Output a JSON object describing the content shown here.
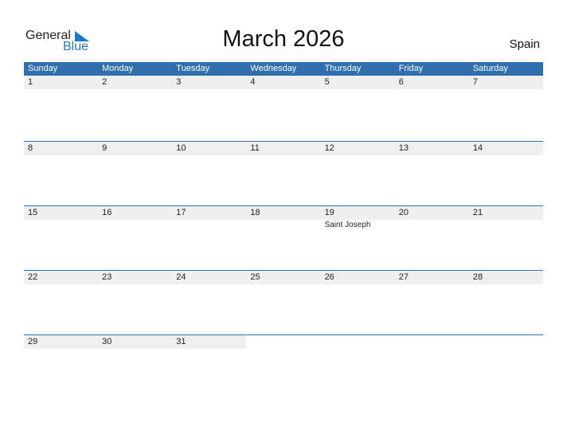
{
  "logo": {
    "general": "General",
    "blue": "Blue"
  },
  "header": {
    "title": "March 2026",
    "country": "Spain"
  },
  "weekdays": [
    "Sunday",
    "Monday",
    "Tuesday",
    "Wednesday",
    "Thursday",
    "Friday",
    "Saturday"
  ],
  "weeks": [
    [
      {
        "d": "1"
      },
      {
        "d": "2"
      },
      {
        "d": "3"
      },
      {
        "d": "4"
      },
      {
        "d": "5"
      },
      {
        "d": "6"
      },
      {
        "d": "7"
      }
    ],
    [
      {
        "d": "8"
      },
      {
        "d": "9"
      },
      {
        "d": "10"
      },
      {
        "d": "11"
      },
      {
        "d": "12"
      },
      {
        "d": "13"
      },
      {
        "d": "14"
      }
    ],
    [
      {
        "d": "15"
      },
      {
        "d": "16"
      },
      {
        "d": "17"
      },
      {
        "d": "18"
      },
      {
        "d": "19",
        "h": "Saint Joseph"
      },
      {
        "d": "20"
      },
      {
        "d": "21"
      }
    ],
    [
      {
        "d": "22"
      },
      {
        "d": "23"
      },
      {
        "d": "24"
      },
      {
        "d": "25"
      },
      {
        "d": "26"
      },
      {
        "d": "27"
      },
      {
        "d": "28"
      }
    ],
    [
      {
        "d": "29"
      },
      {
        "d": "30"
      },
      {
        "d": "31"
      },
      {
        "d": ""
      },
      {
        "d": ""
      },
      {
        "d": ""
      },
      {
        "d": ""
      }
    ]
  ],
  "colors": {
    "accent": "#2f6fad",
    "date_strip": "#efefef",
    "logo_blue": "#1f7ac4"
  }
}
